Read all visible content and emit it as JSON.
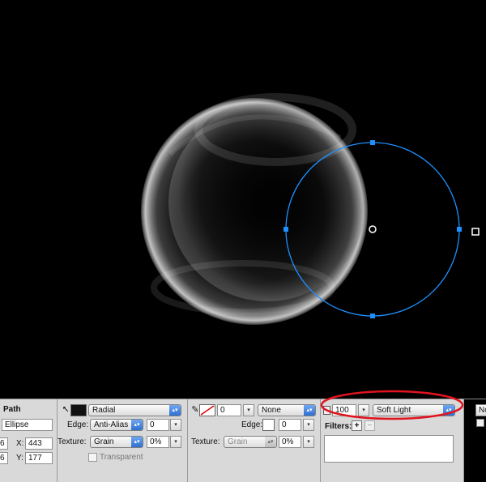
{
  "canvas": {
    "background": "#000000",
    "selection_color": "#1e90ff"
  },
  "object_info": {
    "type_label": "Path",
    "name_value": "Ellipse",
    "w_value": "6",
    "h_value": "6",
    "x_label": "X:",
    "x_value": "443",
    "y_label": "Y:",
    "y_value": "177"
  },
  "fill": {
    "type_value": "Radial",
    "edge_label": "Edge:",
    "edge_value": "Anti-Alias",
    "edge_amount": "0",
    "texture_label": "Texture:",
    "texture_value": "Grain",
    "texture_amount": "0%",
    "transparent_label": "Transparent"
  },
  "stroke": {
    "size_value": "0",
    "type_value": "None",
    "edge_label": "Edge:",
    "edge_amount": "0",
    "texture_label": "Texture:",
    "texture_value": "Grain",
    "texture_amount": "0%"
  },
  "effects": {
    "opacity_value": "100",
    "blend_value": "Soft Light",
    "filters_label": "Filters:",
    "add_filter_icon": "plus-icon",
    "remove_filter_icon": "minus-icon",
    "highlight_color": "#e0141e",
    "right_button": "No"
  }
}
